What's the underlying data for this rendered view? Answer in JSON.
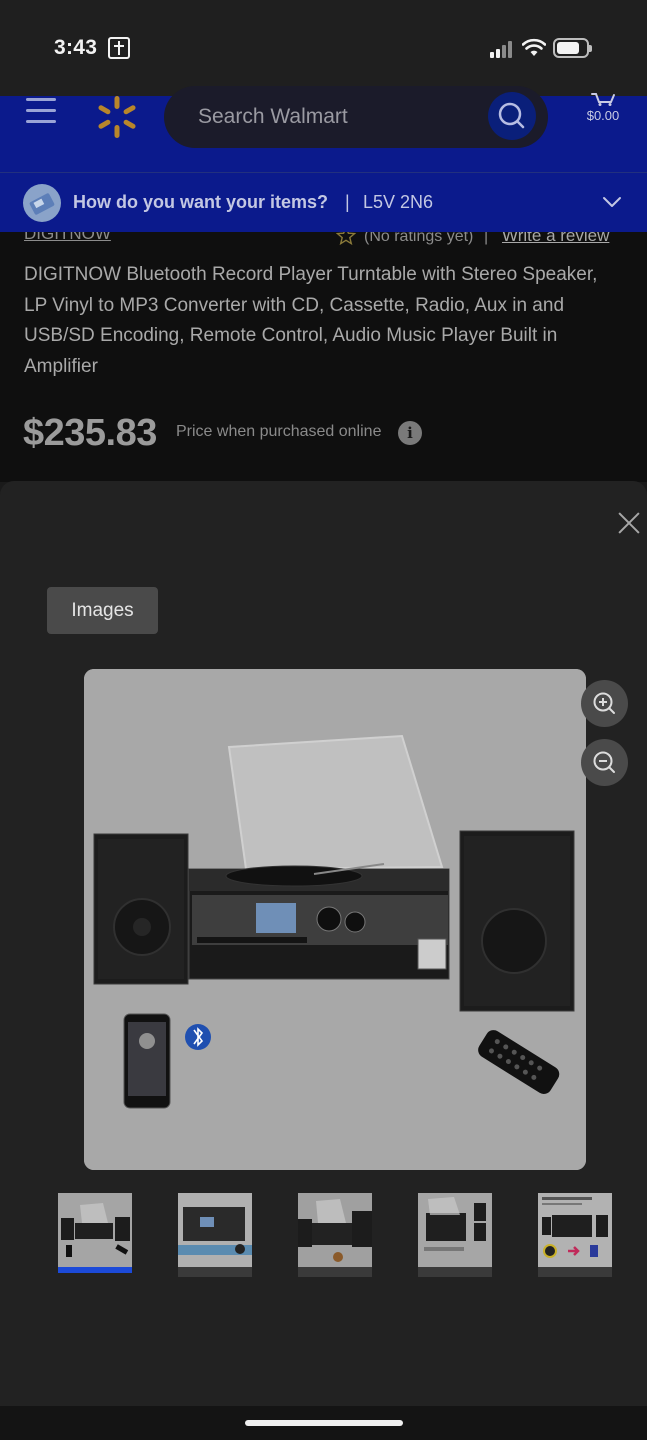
{
  "status_bar": {
    "time": "3:43",
    "app_icon": "bible-app-icon",
    "signal_icon": "cellular-signal-icon",
    "wifi_icon": "wifi-icon",
    "battery_icon": "battery-icon"
  },
  "header": {
    "menu_icon": "hamburger-menu-icon",
    "logo_icon": "walmart-spark-icon",
    "search_placeholder": "Search Walmart",
    "search_icon": "search-icon",
    "cart_icon": "cart-icon",
    "cart_total": "$0.00",
    "brand_color": "#0b1a8c",
    "spark_color": "#e0a52a"
  },
  "location_bar": {
    "question": "How do you want your items?",
    "divider": "|",
    "postal_code": "L5V 2N6",
    "chevron_icon": "chevron-down-icon"
  },
  "product": {
    "brand": "DIGITNOW",
    "rating_text": "(No ratings yet)",
    "rating_divider": "|",
    "review_link": "Write a review",
    "title": "DIGITNOW Bluetooth Record Player Turntable with Stereo Speaker, LP Vinyl to MP3 Converter with CD, Cassette, Radio, Aux in and USB/SD Encoding, Remote Control, Audio Music Player Built in Amplifier",
    "price": "$235.83",
    "price_note": "Price when purchased online",
    "info_icon": "info-icon",
    "info_glyph": "i"
  },
  "gallery": {
    "close_icon": "close-icon",
    "tab_label": "Images",
    "zoom_in_icon": "zoom-in-icon",
    "zoom_out_icon": "zoom-out-icon",
    "bluetooth_icon": "bluetooth-icon",
    "selected_thumbnail": 1,
    "thumbnail_count": 5,
    "active_color": "#1c4ad8"
  }
}
